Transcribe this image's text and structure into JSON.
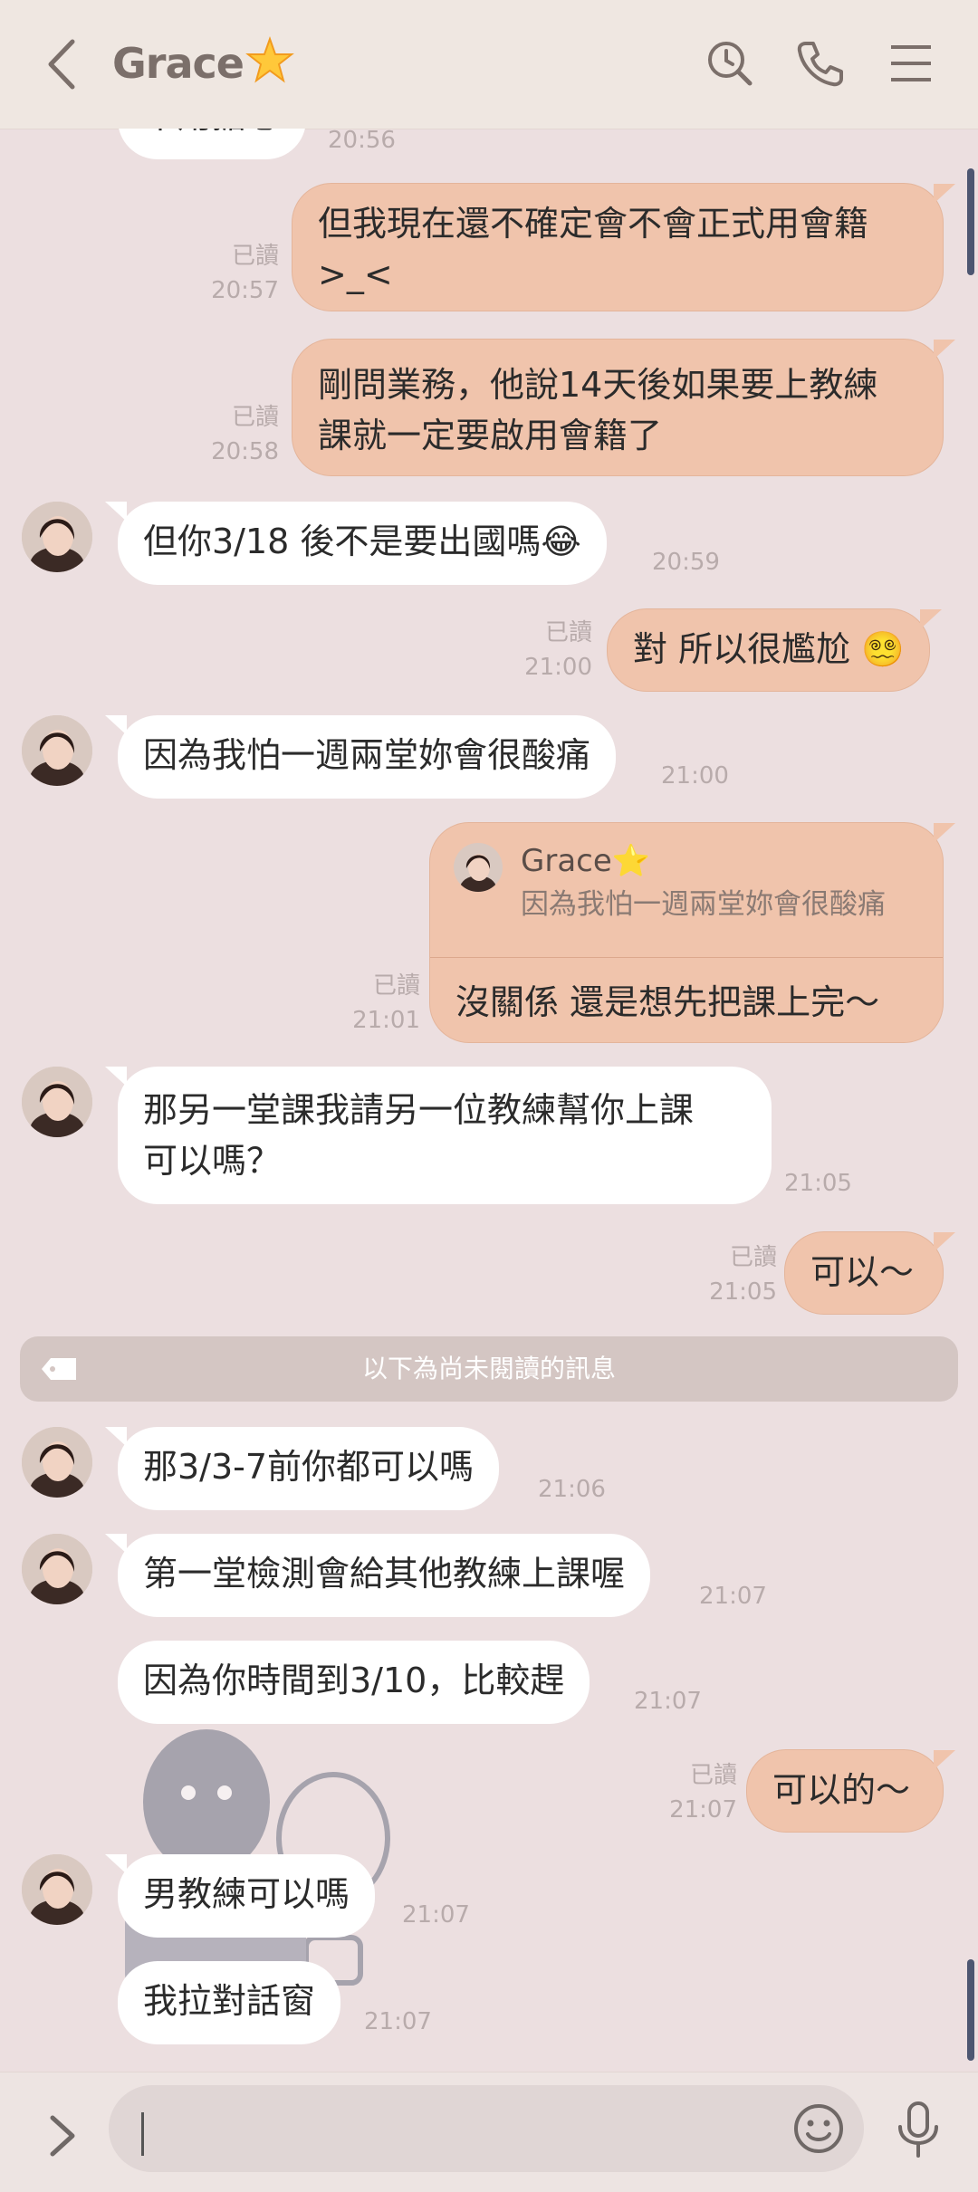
{
  "header": {
    "title": "Grace",
    "title_emoji": "star",
    "icons": [
      "back-icon",
      "history-search-icon",
      "phone-icon",
      "menu-icon"
    ]
  },
  "messages": [
    {
      "side": "in",
      "text": "不用擔心",
      "time": "20:56"
    },
    {
      "side": "out",
      "lines": [
        "但我現在還不確定會不會正式用會籍",
        ">_<"
      ],
      "read": "已讀",
      "time": "20:57"
    },
    {
      "side": "out",
      "lines": [
        "剛問業務，他說14天後如果要上教練",
        "課就一定要啟用會籍了"
      ],
      "read": "已讀",
      "time": "20:58"
    },
    {
      "side": "in",
      "text": "但你3/18 後不是要出國嗎😂",
      "time": "20:59"
    },
    {
      "side": "out",
      "text": "對 所以很尷尬 😵‍💫",
      "read": "已讀",
      "time": "21:00"
    },
    {
      "side": "in",
      "text": "因為我怕一週兩堂妳會很酸痛",
      "time": "21:00"
    },
    {
      "side": "out",
      "reply": {
        "name": "Grace⭐",
        "quote": "因為我怕一週兩堂妳會很酸痛"
      },
      "text": "沒關係 還是想先把課上完～",
      "read": "已讀",
      "time": "21:01"
    },
    {
      "side": "in",
      "lines": [
        "那另一堂課我請另一位教練幫你上課",
        "可以嗎？"
      ],
      "time": "21:05"
    },
    {
      "side": "out",
      "text": "可以～",
      "read": "已讀",
      "time": "21:05"
    },
    {
      "side": "in",
      "text": "那3/3-7前你都可以嗎",
      "time": "21:06"
    },
    {
      "side": "in",
      "text": "第一堂檢測會給其他教練上課喔",
      "time": "21:07"
    },
    {
      "side": "in",
      "text": "因為你時間到3/10，比較趕",
      "time": "21:07"
    },
    {
      "side": "out",
      "text": "可以的～",
      "read": "已讀",
      "time": "21:07"
    },
    {
      "side": "in",
      "text": "男教練可以嗎",
      "time": "21:07"
    },
    {
      "side": "in",
      "text": "我拉對話窗",
      "time": "21:07"
    }
  ],
  "unread_divider": "以下為尚未閱讀的訊息",
  "input": {
    "value": "",
    "icons": [
      "expand-icon",
      "emoji-icon",
      "microphone-icon"
    ]
  },
  "colors": {
    "background": "#ecdfe0",
    "incoming_bubble": "#ffffff",
    "outgoing_bubble": "#f0c4ac",
    "header": "#efe7e1",
    "meta_text": "#b8abab"
  }
}
